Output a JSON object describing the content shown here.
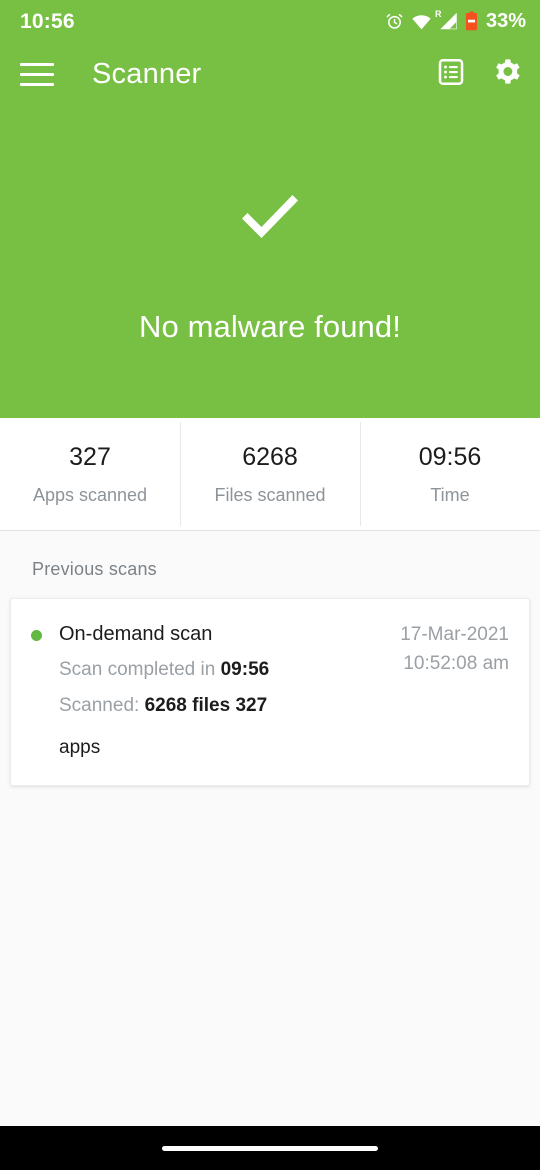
{
  "status_bar": {
    "clock": "10:56",
    "battery_percent": "33%",
    "icons": [
      "alarm-icon",
      "wifi-icon",
      "cellular-signal-icon",
      "battery-icon"
    ],
    "roaming_indicator": "R",
    "text_color": "#ffffff",
    "battery_color": "#f4511e"
  },
  "app_bar": {
    "menu_icon": "hamburger-menu-icon",
    "title": "Scanner",
    "actions": [
      {
        "icon": "scan-log-icon",
        "name": "scan-log-button"
      },
      {
        "icon": "settings-gear-icon",
        "name": "settings-button"
      }
    ],
    "background": "#78c043"
  },
  "result": {
    "icon": "check-mark-icon",
    "message": "No malware found!"
  },
  "stats": [
    {
      "value": "327",
      "label": "Apps scanned",
      "name": "apps-scanned"
    },
    {
      "value": "6268",
      "label": "Files scanned",
      "name": "files-scanned"
    },
    {
      "value": "09:56",
      "label": "Time",
      "name": "scan-time"
    }
  ],
  "previous_scans": {
    "section_title": "Previous scans",
    "items": [
      {
        "status_color": "#62b840",
        "title": "On-demand scan",
        "completed_label": "Scan completed in",
        "completed_value": "09:56",
        "scanned_label": "Scanned:",
        "scanned_files": "6268",
        "scanned_files_unit": "files",
        "scanned_apps": "327",
        "scanned_apps_unit": "apps",
        "date": "17-Mar-2021",
        "time": "10:52:08 am"
      }
    ]
  },
  "nav_bar": {
    "gesture_pill": "home-gesture-pill",
    "background": "#000000"
  }
}
